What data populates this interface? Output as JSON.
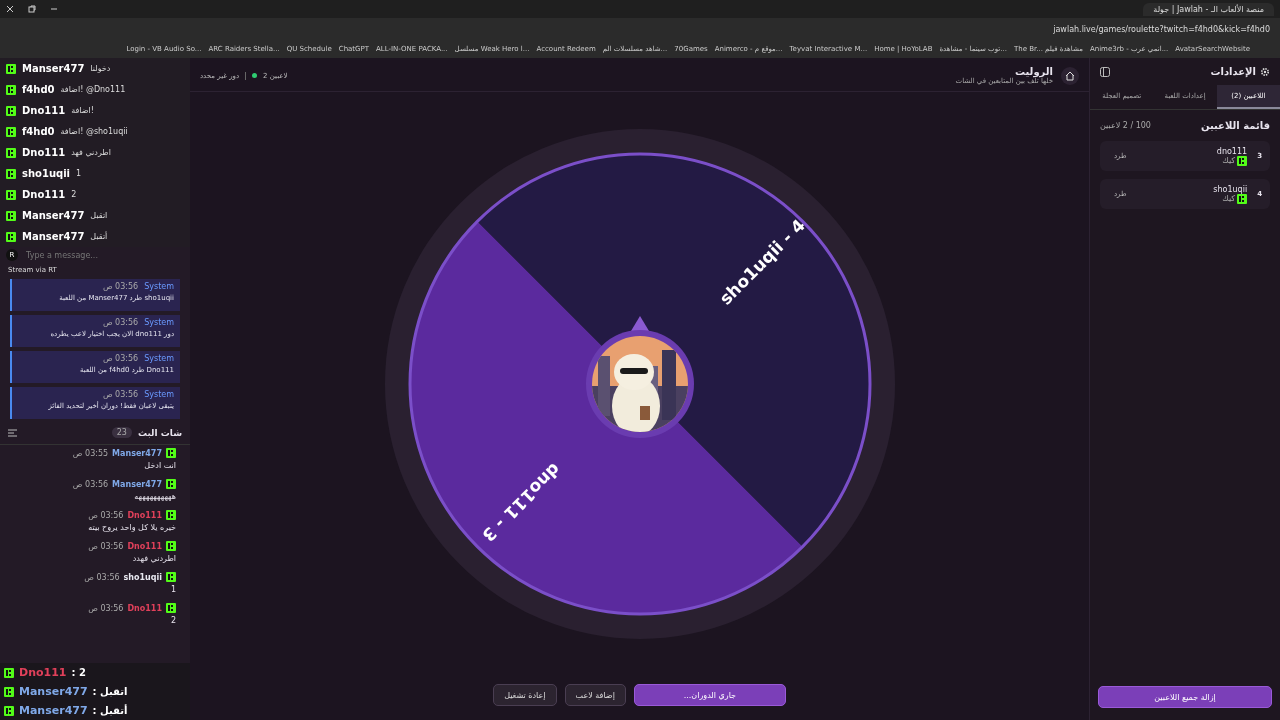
{
  "browser": {
    "tab_title": "جولة | Jawlah - منصة الألعاب الـ",
    "url": "jawlah.live/games/roulette?twitch=f4hd0&kick=f4hd0",
    "bookmarks": [
      "AvatarSearchWebsite",
      "Anime3rb - انمي عرب...",
      "The Br... مشاهدة فيلم",
      "توب سينما - مشاهدة...",
      "Home | HoYoLAB",
      "Teyvat Interactive M...",
      "Animerco - موقع م...",
      "70Games",
      "شاهد مسلسلات الم...",
      "Account Redeem",
      "مسلسل Weak Hero ا...",
      "ALL-IN-ONE PACKA...",
      "ChatGPT",
      "QU Schedule",
      "ARC Raiders Stella...",
      "Login - VB Audio So..."
    ]
  },
  "overlay_chat_top": [
    {
      "user": "Manser477",
      "text": "دخولنا"
    },
    {
      "user": "f4hd0",
      "text": "اضافة! @Dno111"
    },
    {
      "user": "Dno111",
      "text": "اضافة!"
    },
    {
      "user": "f4hd0",
      "text": "اضافة! @sho1uqii"
    },
    {
      "user": "Dno111",
      "text": "اطردني فهد"
    },
    {
      "user": "sho1uqii",
      "text": "1"
    },
    {
      "user": "Dno111",
      "text": "2"
    },
    {
      "user": "Manser477",
      "text": "اتقبل"
    },
    {
      "user": "Manser477",
      "text": "أتقبل"
    }
  ],
  "message_input": {
    "placeholder": "Type a message...",
    "avatar": "R"
  },
  "stream_label": "Stream via RT",
  "system_log": [
    {
      "sender": "System",
      "time": "03:56 ص",
      "text": "sho1uqii طرد Manser477 من اللعبة"
    },
    {
      "sender": "System",
      "time": "03:56 ص",
      "text": "دور dno111 الان يجب اختيار لاعب يطرده"
    },
    {
      "sender": "System",
      "time": "03:56 ص",
      "text": "Dno111 طرد f4hd0 من اللعبة"
    },
    {
      "sender": "System",
      "time": "03:56 ص",
      "text": "يتبقى لاعبان فقط! دوران أخير لتحديد الفائز"
    }
  ],
  "stream_chat": {
    "title": "شات البث",
    "count": "23",
    "messages": [
      {
        "user": "Manser477",
        "color": "#7fa8e8",
        "time": "03:55 ص",
        "text": "انت ادخل"
      },
      {
        "user": "Manser477",
        "color": "#7fa8e8",
        "time": "03:56 ص",
        "text": "ههههههههههه"
      },
      {
        "user": "Dno111",
        "color": "#e0405a",
        "time": "03:56 ص",
        "text": "خيره يلا كل واحد يروح بيته"
      },
      {
        "user": "Dno111",
        "color": "#e0405a",
        "time": "03:56 ص",
        "text": "اطردني فهدد"
      },
      {
        "user": "sho1uqii",
        "color": "#e8e8f0",
        "time": "03:56 ص",
        "text": "1"
      },
      {
        "user": "Dno111",
        "color": "#e0405a",
        "time": "03:56 ص",
        "text": "2"
      }
    ]
  },
  "overlay_chat_bottom": [
    {
      "user": "Dno111",
      "color": "#e0405a",
      "text": ": 2"
    },
    {
      "user": "Manser477",
      "color": "#7fa8e8",
      "text": ": اتقبل"
    },
    {
      "user": "Manser477",
      "color": "#7fa8e8",
      "text": ": أتقبل"
    }
  ],
  "game": {
    "title": "الروليت",
    "subtitle": "خلها تلف بين المتابعين في الشات",
    "players_count": "2 لاعبين",
    "turn": "دور غير محدد"
  },
  "wheel": {
    "segments": [
      {
        "label": "dno111 - 3",
        "color": "#5b2a9e"
      },
      {
        "label": "sho1uqii - 4",
        "color": "#231a44"
      }
    ]
  },
  "actions": [
    {
      "label": "جاري الدوران...",
      "kind": "primary"
    },
    {
      "label": "إضافة لاعب",
      "kind": "secondary"
    },
    {
      "label": "إعادة تشغيل",
      "kind": "secondary"
    }
  ],
  "settings": {
    "title": "الإعدادات",
    "tabs": [
      {
        "label": "اللاعبين (2)",
        "selected": true
      },
      {
        "label": "إعدادات اللعبة",
        "selected": false
      },
      {
        "label": "تصميم العجلة",
        "selected": false
      }
    ],
    "list_title": "قائمة اللاعبين",
    "list_count": "100 / 2 لاعبين",
    "players": [
      {
        "number": "3",
        "name": "dno111",
        "platform": "كيك",
        "action": "طرد"
      },
      {
        "number": "4",
        "name": "sho1uqii",
        "platform": "كيك",
        "action": "طرد"
      }
    ],
    "remove_all": "إزالة جميع اللاعبين"
  }
}
